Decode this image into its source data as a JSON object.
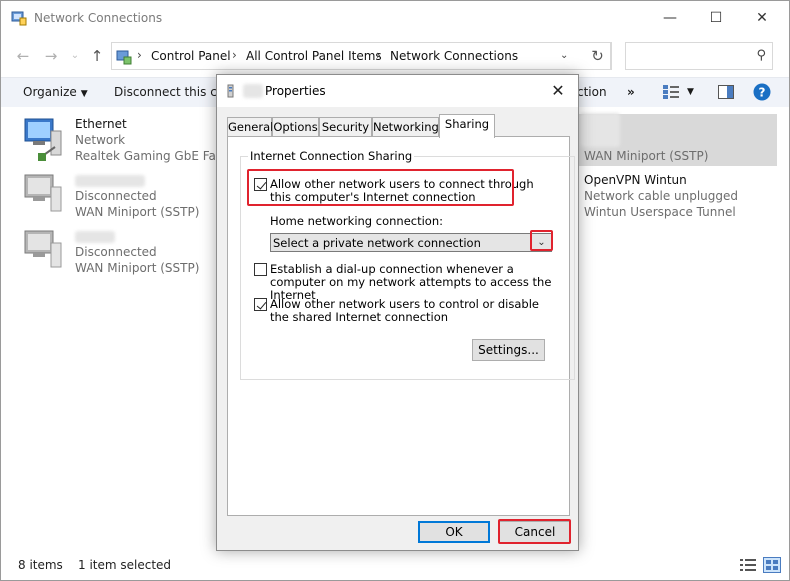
{
  "window": {
    "title": "Network Connections"
  },
  "address": {
    "crumbs": [
      "Control Panel",
      "All Control Panel Items",
      "Network Connections"
    ]
  },
  "search": {
    "placeholder": ""
  },
  "toolbar": {
    "organize": "Organize",
    "disconnect": "Disconnect this con",
    "right_fragment": "ction",
    "more": "»"
  },
  "connections": [
    {
      "name": "Ethernet",
      "line2": "Network",
      "line3": "Realtek Gaming GbE Family"
    },
    {
      "name": "",
      "line2": "Disconnected",
      "line3": "WAN Miniport (SSTP)"
    },
    {
      "name": "",
      "line2": "Disconnected",
      "line3": "WAN Miniport (SSTP)"
    },
    {
      "name": "",
      "line2": "",
      "line3": "WAN Miniport (SSTP)"
    },
    {
      "name": "OpenVPN Wintun",
      "line2": "Network cable unplugged",
      "line3": "Wintun Userspace Tunnel"
    }
  ],
  "status": {
    "items": "8 items",
    "selected": "1 item selected"
  },
  "dialog": {
    "title": "Properties",
    "tabs": [
      "General",
      "Options",
      "Security",
      "Networking",
      "Sharing"
    ],
    "active_tab": "Sharing",
    "group_title": "Internet Connection Sharing",
    "allow_connect": "Allow other network users to connect through this computer's Internet connection",
    "home_label": "Home networking connection:",
    "home_select_value": "Select a private network connection",
    "dialup": "Establish a dial-up connection whenever a computer on my network attempts to access the Internet",
    "allow_control": "Allow other network users to control or disable the shared Internet connection",
    "settings_button": "Settings...",
    "ok_button": "OK",
    "cancel_button": "Cancel"
  },
  "colors": {
    "highlight": "#e0232e",
    "accent": "#0078d7",
    "help": "#1a6fc4"
  }
}
